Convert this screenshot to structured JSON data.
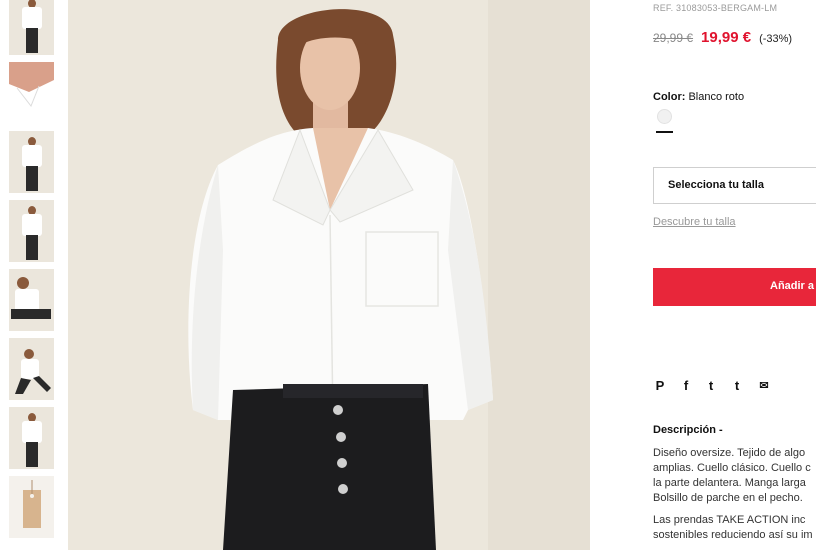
{
  "gallery": {
    "thumbnails": [
      {
        "index": 1,
        "view": "model-front"
      },
      {
        "index": 2,
        "view": "collar-detail"
      },
      {
        "index": 3,
        "view": "model-full"
      },
      {
        "index": 4,
        "view": "model-full-side"
      },
      {
        "index": 5,
        "view": "model-sitting"
      },
      {
        "index": 6,
        "view": "model-crouching"
      },
      {
        "index": 7,
        "view": "model-full-back"
      },
      {
        "index": 8,
        "view": "product-tag"
      }
    ]
  },
  "product": {
    "reference": "REF. 31083053-BERGAM-LM",
    "old_price": "29,99 €",
    "price": "19,99 €",
    "discount": "(-33%)",
    "color_label": "Color:",
    "color_value": "Blanco roto",
    "size_placeholder": "Selecciona tu talla",
    "size_guide": "Descubre tu talla",
    "add_button": "Añadir a",
    "description_title": "Descripción -",
    "description_paragraphs": [
      [
        "Diseño oversize. Tejido de algo",
        "amplias. Cuello clásico. Cuello c",
        "la parte delantera. Manga larga",
        "Bolsillo de parche en el pecho."
      ],
      [
        "Las prendas TAKE ACTION inc",
        "sostenibles reduciendo así su im"
      ]
    ]
  },
  "share": {
    "icons": [
      "pinterest-icon",
      "facebook-icon",
      "twitter-icon",
      "tumblr-icon",
      "mail-icon"
    ],
    "glyphs": [
      "P",
      "f",
      "t",
      "t",
      "✉"
    ]
  },
  "colors": {
    "accent": "#e0132e",
    "button": "#e8263a",
    "background": "#ece7dc"
  }
}
